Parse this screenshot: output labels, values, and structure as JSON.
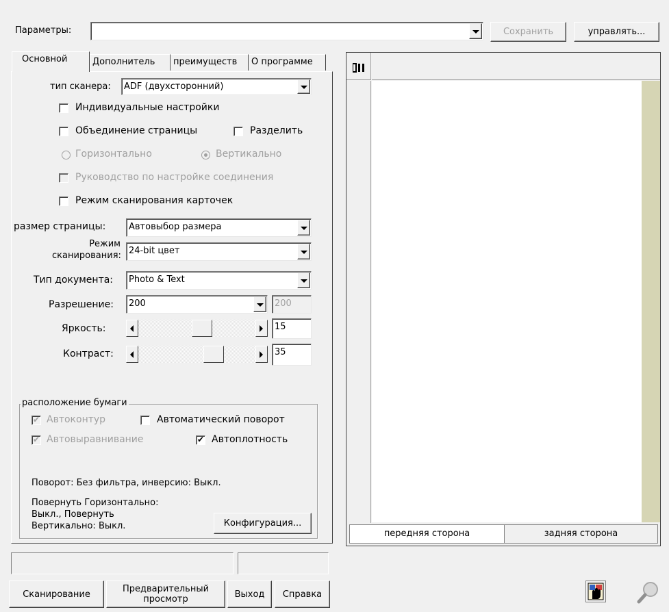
{
  "top": {
    "label": "Параметры:",
    "value": "",
    "save": "Сохранить",
    "manage": "управлять..."
  },
  "tabs": [
    "Основной",
    "Дополнитель",
    "преимуществ",
    "О программе"
  ],
  "basic": {
    "scanner_type_label": "тип сканера:",
    "scanner_type_value": "ADF (двухсторонний)",
    "individual": "Индивидуальные настройки",
    "merge": "Объединение страницы",
    "split": "Разделить",
    "horizontal": "Горизонтально",
    "vertical": "Вертикально",
    "guide": "Руководство по настройке соединения",
    "card_mode": "Режим сканирования карточек",
    "page_size_label": "размер страницы:",
    "page_size_value": "Автовыбор размера",
    "scan_mode_label_1": "Режим",
    "scan_mode_label_2": "сканирования:",
    "scan_mode_value": "24-bit цвет",
    "doc_type_label": "Тип документа:",
    "doc_type_value": "Photo & Text",
    "resolution_label": "Разрешение:",
    "resolution_value": "200",
    "resolution_box": "200",
    "brightness_label": "Яркость:",
    "brightness_value": "15",
    "contrast_label": "Контраст:",
    "contrast_value": "35"
  },
  "paper": {
    "title": "расположение бумаги",
    "auto_contour": "Автоконтур",
    "auto_rotate": "Автоматический поворот",
    "auto_align": "Автовыравнивание",
    "auto_density": "Автоплотность",
    "rotation_info": "Поворот: Без фильтра, инверсию: Выкл.",
    "flip_info_1": "Повернуть Горизонтально:",
    "flip_info_2": "Выкл., Повернуть",
    "flip_info_3": "Вертикально: Выкл.",
    "config": "Конфигурация..."
  },
  "preview": {
    "front": "передняя сторона",
    "back": "задняя сторона",
    "ruler_icon": "ruler-icon"
  },
  "buttons": {
    "scan": "Сканирование",
    "preview_1": "Предварительный",
    "preview_2": "просмотр",
    "exit": "Выход",
    "help": "Справка"
  },
  "icons": [
    "hand-icon",
    "magnifier-icon"
  ]
}
